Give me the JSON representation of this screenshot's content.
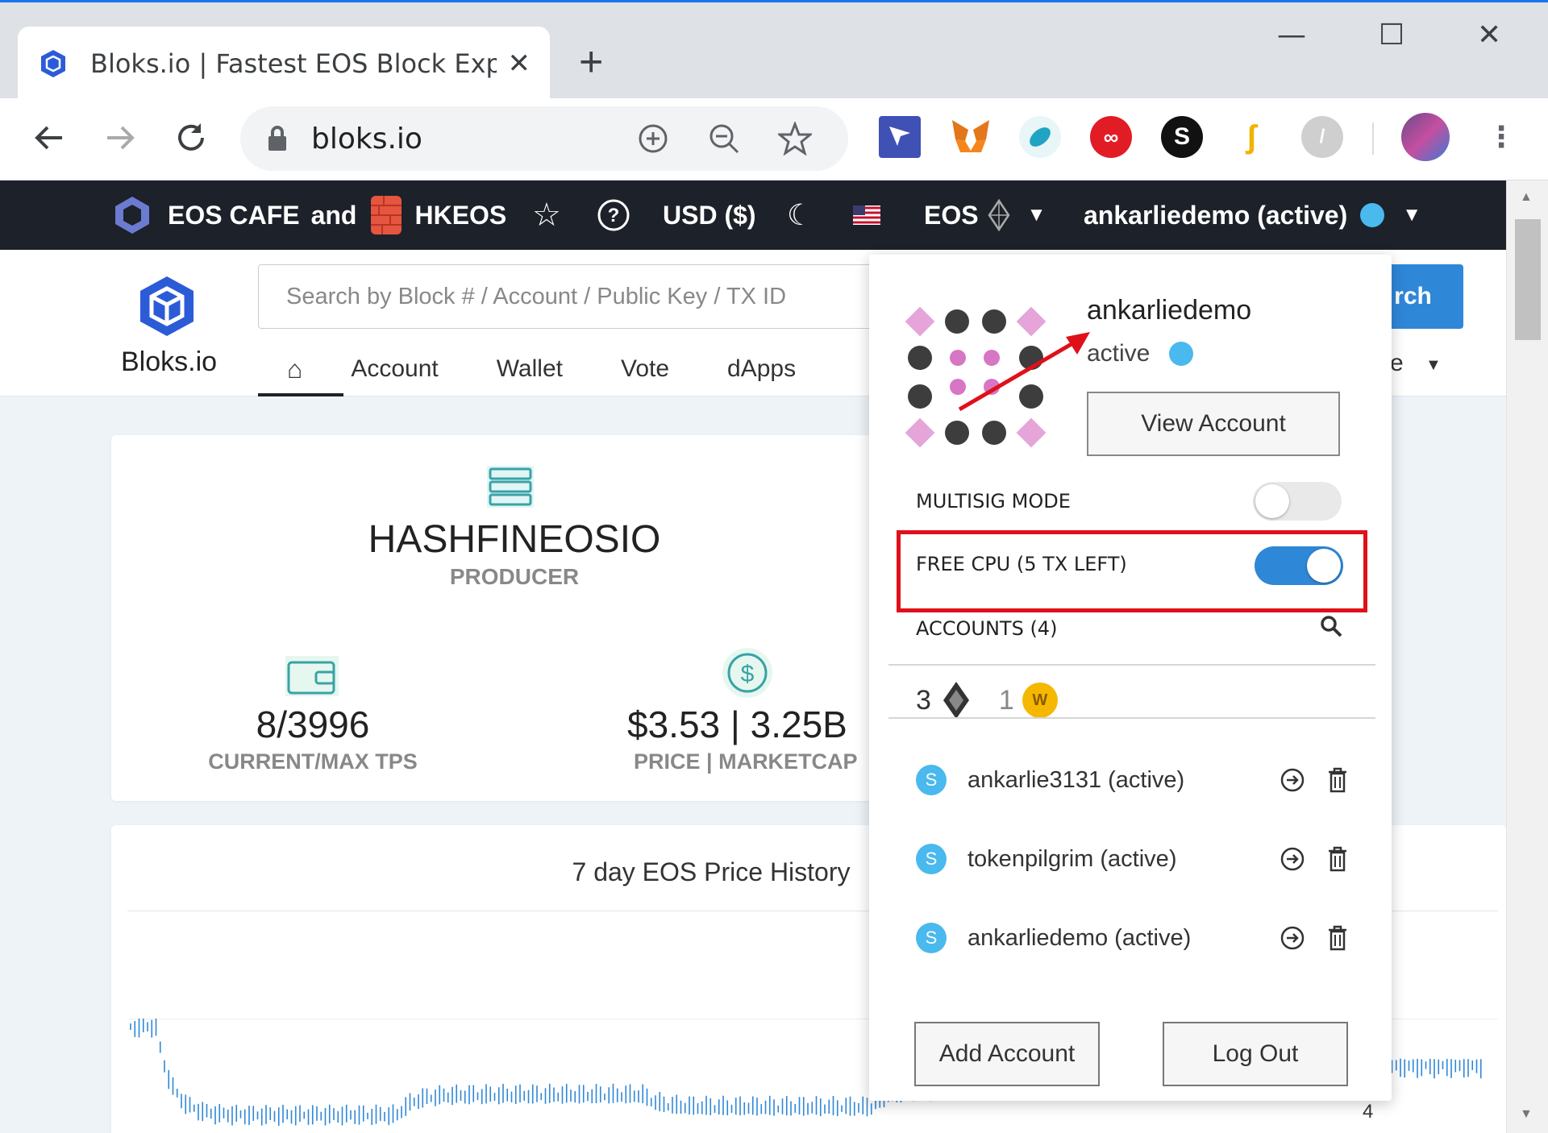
{
  "browser": {
    "tab_title": "Bloks.io | Fastest EOS Block Explo",
    "url": "bloks.io"
  },
  "topbar": {
    "sponsor_1": "EOS CAFE",
    "sponsor_join": "and",
    "sponsor_2": "HKEOS",
    "currency": "USD ($)",
    "network": "EOS",
    "account": "ankarliedemo (active)"
  },
  "header": {
    "logo_text": "Bloks.io",
    "search_placeholder": "Search by Block # / Account / Public Key / TX ID",
    "search_button": "rch",
    "tabs": [
      "Account",
      "Wallet",
      "Vote",
      "dApps"
    ],
    "more_label": "e"
  },
  "producer": {
    "name": "HASHFINEOSIO",
    "role": "PRODUCER"
  },
  "stats": [
    {
      "value": "8/3996",
      "label": "CURRENT/MAX TPS"
    },
    {
      "value": "$3.53 | 3.25B",
      "label": "PRICE | MARKETCAP"
    }
  ],
  "price_card": {
    "title": "7 day EOS Price History",
    "axis_label": "4"
  },
  "panel": {
    "account_name": "ankarliedemo",
    "permission": "active",
    "view_account": "View Account",
    "multisig_label": "MULTISIG MODE",
    "multisig_on": false,
    "free_cpu_label": "FREE CPU (5 TX LEFT)",
    "free_cpu_on": true,
    "accounts_label": "ACCOUNTS (4)",
    "eos_count": "3",
    "wax_count": "1",
    "accounts": [
      {
        "name": "ankarlie3131 (active)"
      },
      {
        "name": "tokenpilgrim (active)"
      },
      {
        "name": "ankarliedemo (active)"
      }
    ],
    "add_account": "Add Account",
    "log_out": "Log Out"
  },
  "colors": {
    "accent": "#2f87d8",
    "topbar_bg": "#1d2129",
    "highlight": "#e0101a",
    "scatter_blue": "#49b9ee"
  }
}
